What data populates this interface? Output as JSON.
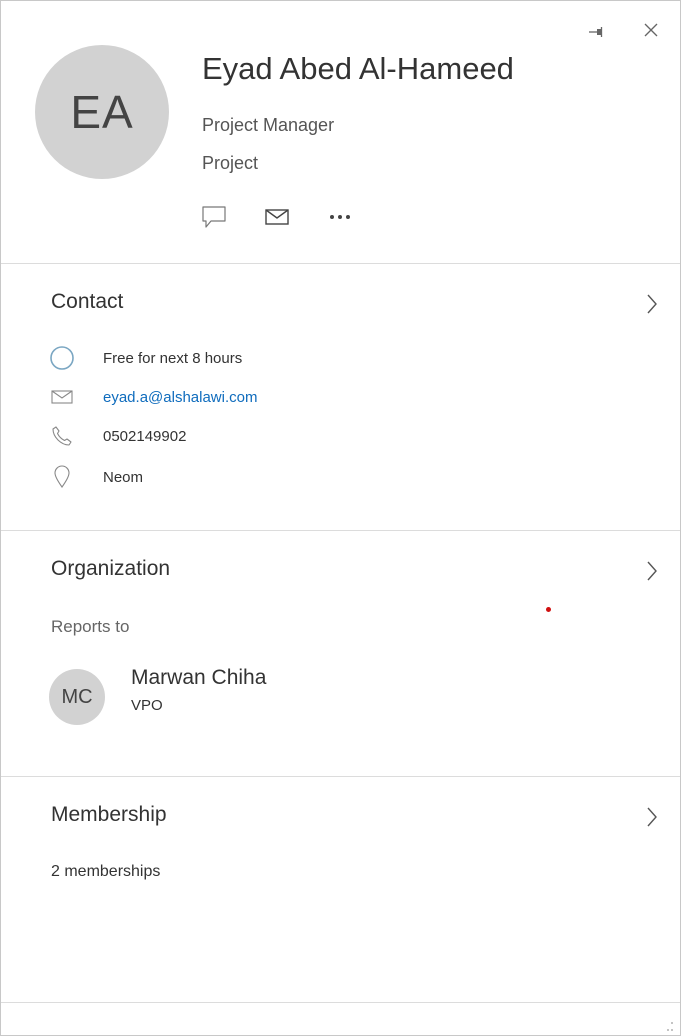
{
  "header": {
    "initials": "EA",
    "name": "Eyad Abed Al-Hameed",
    "job_title": "Project Manager",
    "department": "Project",
    "actions": {
      "chat_icon": "chat-bubble-icon",
      "mail_icon": "mail-icon",
      "more_icon": "more-icon"
    },
    "window_controls": {
      "pin_icon": "pin-icon",
      "close_icon": "close-icon"
    }
  },
  "contact": {
    "title": "Contact",
    "availability": "Free for next 8 hours",
    "email": "eyad.a@alshalawi.com",
    "phone": "0502149902",
    "location": "Neom"
  },
  "organization": {
    "title": "Organization",
    "reports_to_label": "Reports to",
    "manager": {
      "initials": "MC",
      "name": "Marwan Chiha",
      "title": "VPO"
    }
  },
  "membership": {
    "title": "Membership",
    "count_label": "2 memberships"
  },
  "colors": {
    "link": "#0f6cbd",
    "avatar_bg": "#d2d2d2",
    "presence_ring": "#7aa6c2",
    "divider": "#dcdcdc",
    "marker_dot": "#d01010"
  }
}
